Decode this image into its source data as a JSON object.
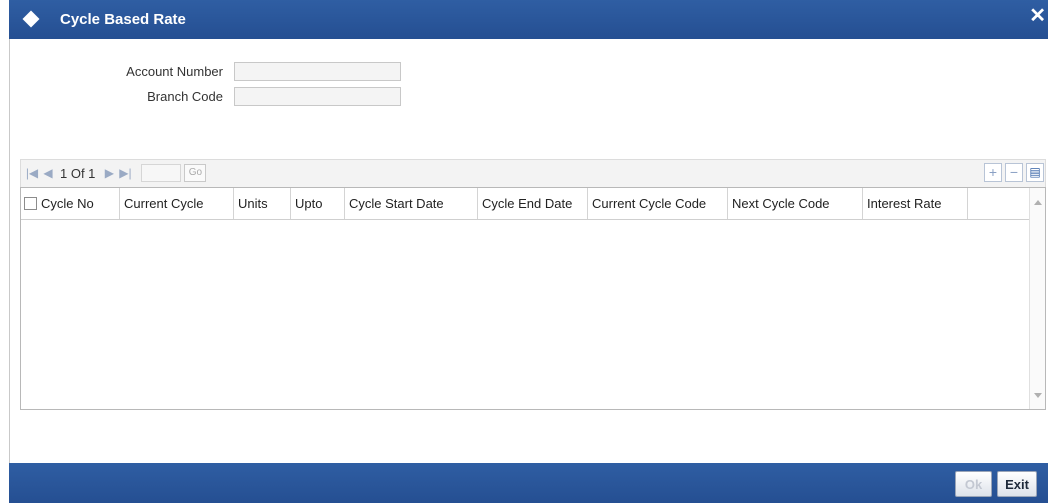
{
  "window": {
    "title": "Cycle Based Rate",
    "close_glyph": "✕"
  },
  "form": {
    "account_number": {
      "label": "Account Number",
      "value": ""
    },
    "branch_code": {
      "label": "Branch Code",
      "value": ""
    }
  },
  "pager": {
    "first_icon": "first-page-icon",
    "prev_icon": "prev-page-icon",
    "status": "1 Of 1",
    "next_icon": "next-page-icon",
    "last_icon": "last-page-icon",
    "page_input": "",
    "go_label": "Go"
  },
  "grid_actions": {
    "add": "+",
    "remove": "−",
    "view": "▤"
  },
  "grid": {
    "columns": [
      "Cycle No",
      "Current Cycle",
      "Units",
      "Upto",
      "Cycle Start Date",
      "Cycle End Date",
      "Current Cycle Code",
      "Next Cycle Code",
      "Interest Rate",
      ""
    ],
    "rows": []
  },
  "footer": {
    "ok_label": "Ok",
    "exit_label": "Exit"
  },
  "colors": {
    "header_blue": "#2f5ea3",
    "panel_border": "#b8b8b8"
  }
}
